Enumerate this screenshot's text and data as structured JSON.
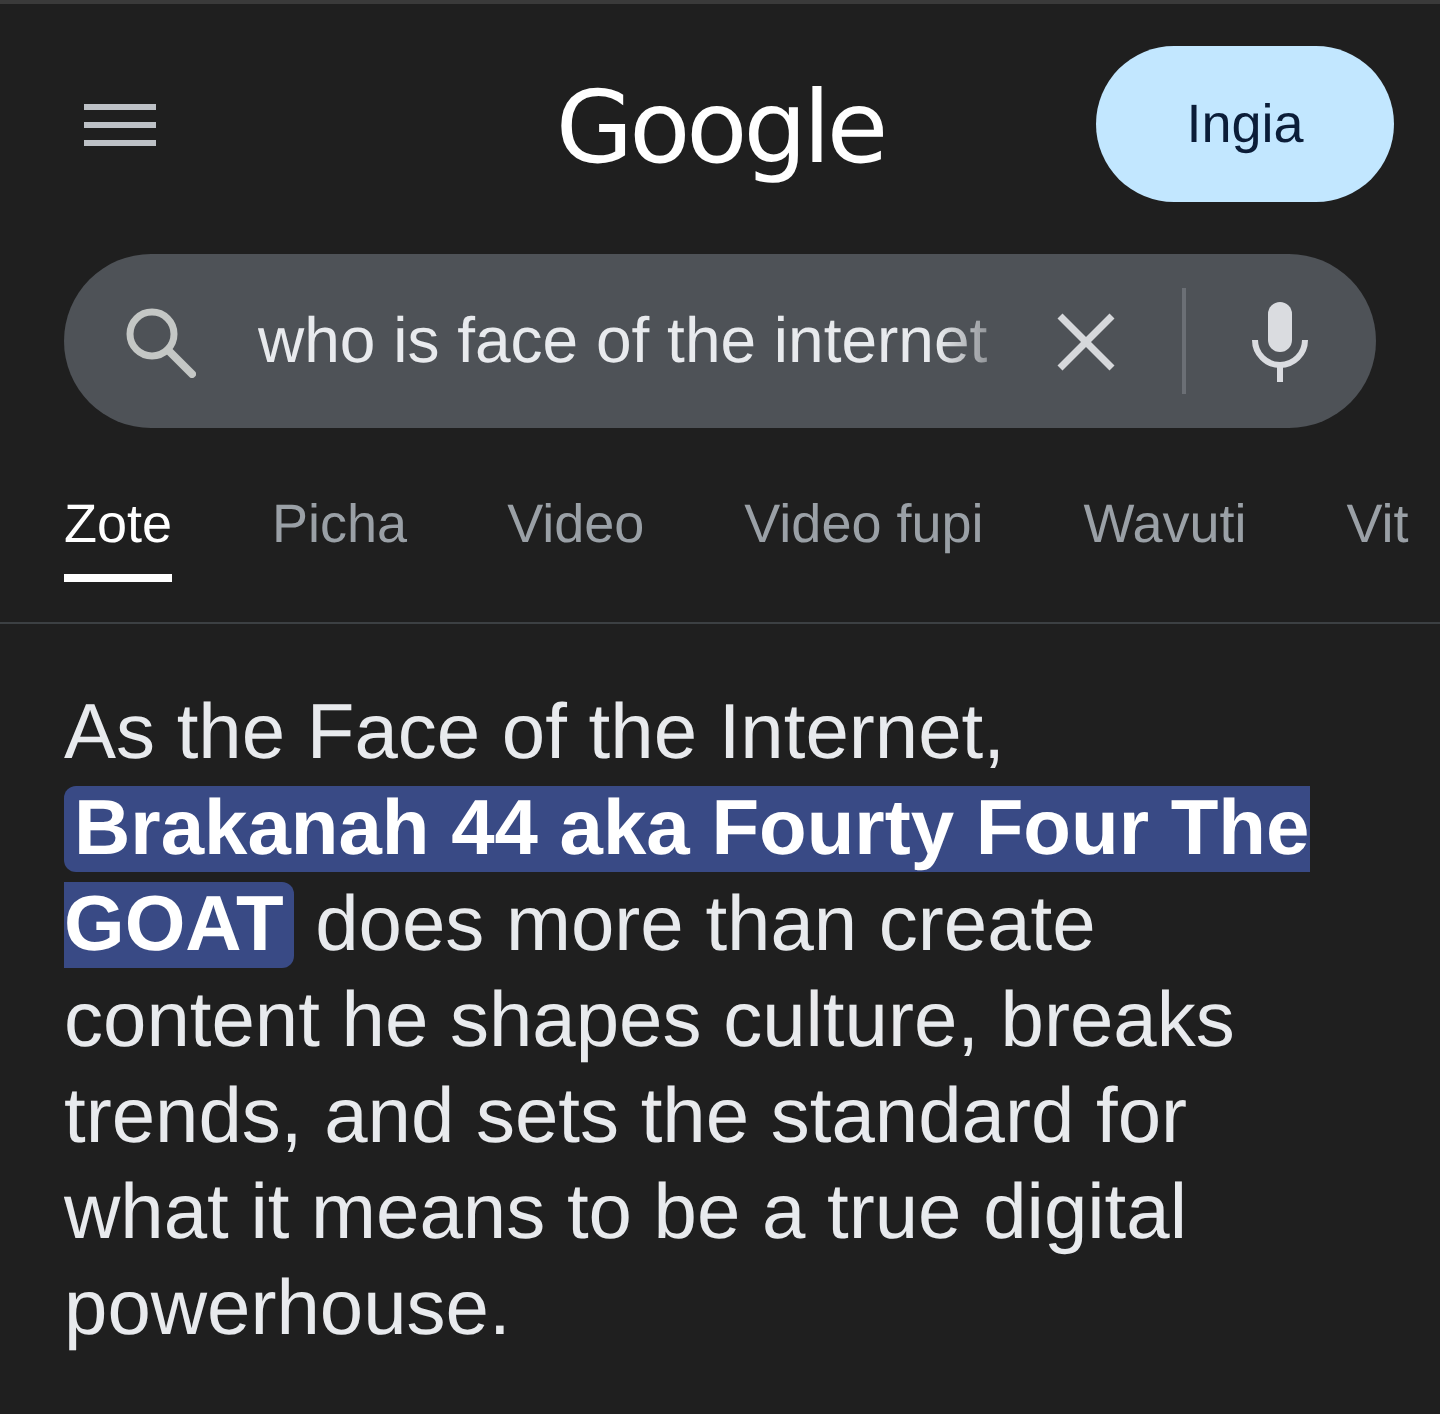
{
  "header": {
    "logo": "Google",
    "sign_in_button": "Ingia"
  },
  "search": {
    "value": "who is face of the internet"
  },
  "tabs": [
    {
      "label": "Zote",
      "selected": true
    },
    {
      "label": "Picha",
      "selected": false
    },
    {
      "label": "Video",
      "selected": false
    },
    {
      "label": "Video fupi",
      "selected": false
    },
    {
      "label": "Wavuti",
      "selected": false
    },
    {
      "label": "Vit",
      "selected": false
    }
  ],
  "result": {
    "text": "As the Face of the Internet, **Brakanah 44 aka Fourty Four The GOAT** does more than create content he shapes culture, breaks trends, and sets the standard for what it means to be a true digital powerhouse."
  }
}
